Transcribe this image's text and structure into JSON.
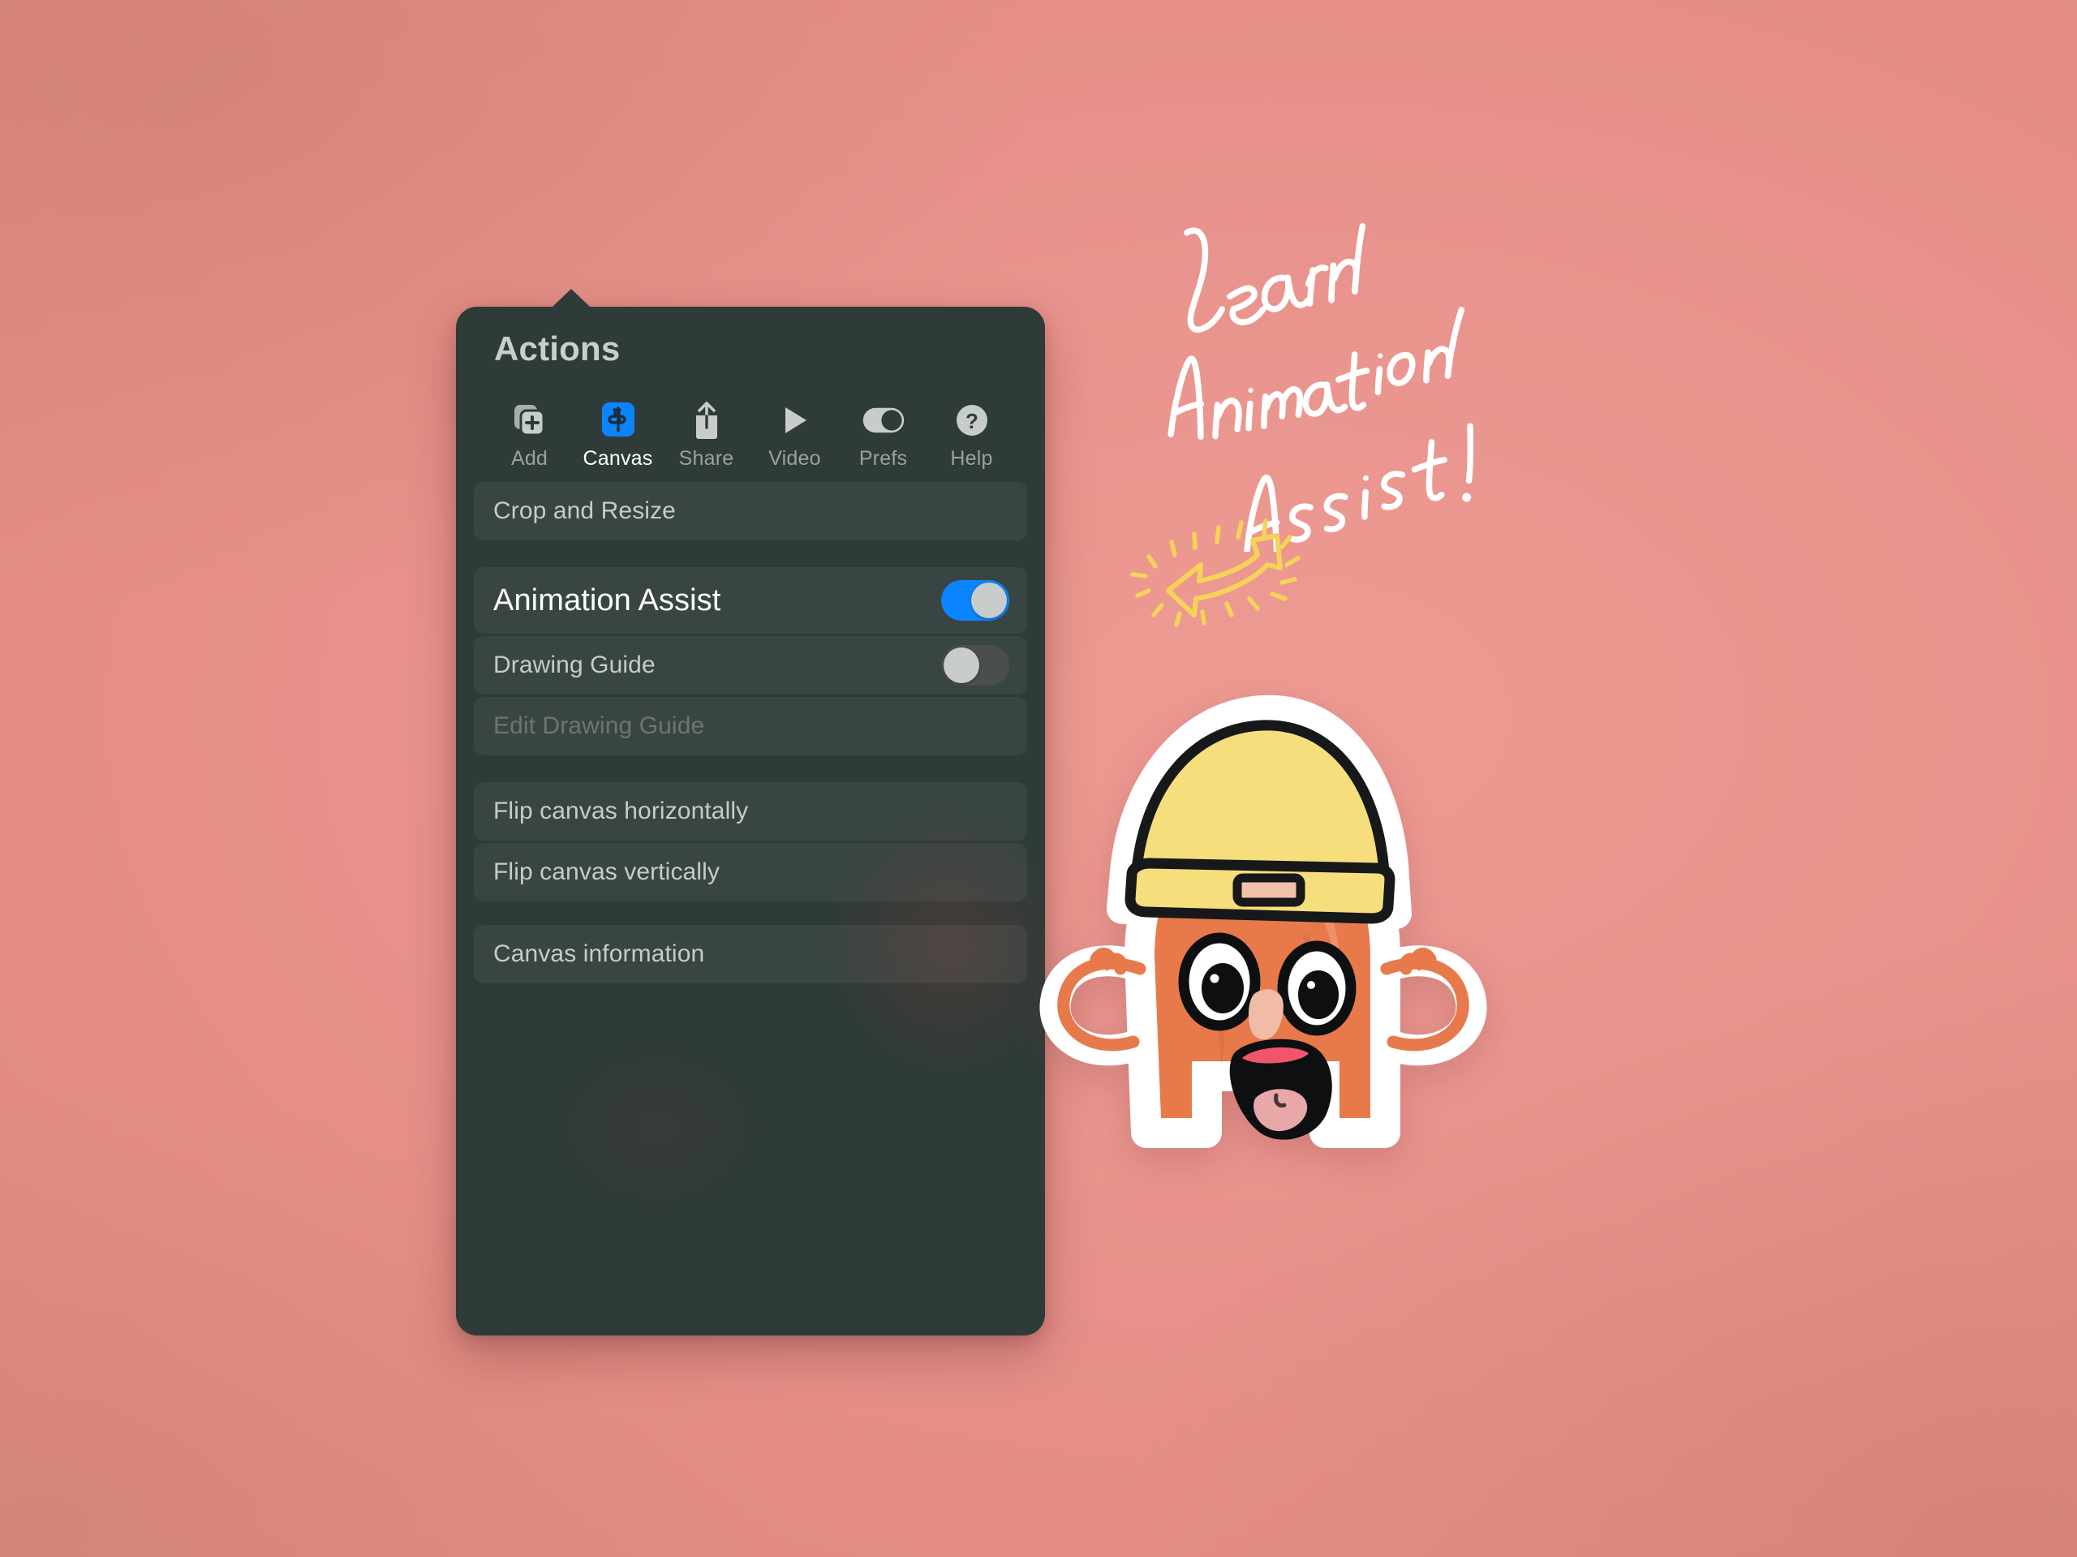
{
  "background": {
    "gradient_from": "#D28677",
    "gradient_to": "#E8918C"
  },
  "panel": {
    "title": "Actions",
    "background_color": "#2E3B39",
    "accent_color": "#0A84FF",
    "tabs": [
      {
        "label": "Add",
        "icon": "add-layer-icon",
        "active": false
      },
      {
        "label": "Canvas",
        "icon": "canvas-icon",
        "active": true
      },
      {
        "label": "Share",
        "icon": "share-icon",
        "active": false
      },
      {
        "label": "Video",
        "icon": "video-play-icon",
        "active": false
      },
      {
        "label": "Prefs",
        "icon": "toggle-icon",
        "active": false
      },
      {
        "label": "Help",
        "icon": "question-mark-icon",
        "active": false
      }
    ],
    "rows": [
      {
        "label": "Crop and Resize",
        "type": "action",
        "disabled": false
      },
      {
        "label": "Animation Assist",
        "type": "toggle",
        "value": "on",
        "emphasis": true
      },
      {
        "label": "Drawing Guide",
        "type": "toggle",
        "value": "off",
        "emphasis": false
      },
      {
        "label": "Edit Drawing Guide",
        "type": "action",
        "disabled": true
      },
      {
        "label": "Flip canvas horizontally",
        "type": "action",
        "disabled": false
      },
      {
        "label": "Flip canvas vertically",
        "type": "action",
        "disabled": false
      },
      {
        "label": "Canvas information",
        "type": "action",
        "disabled": false
      }
    ]
  },
  "annotations": {
    "handwritten_text": "Learn Animation Assist!",
    "handwritten_lines": [
      "Learn",
      "Animation",
      "Assist !"
    ],
    "handwritten_color": "#FFFFFF",
    "arrow": {
      "name": "hand-drawn-arrow-left",
      "color": "#F5D357",
      "direction": "left",
      "sparkles": true
    }
  },
  "sticker": {
    "name": "orange-character-with-beanie",
    "body_color": "#E8794B",
    "outline_color": "#FFFFFF",
    "hat_color": "#F7DE7C",
    "hat_outline_color": "#16181A",
    "tongue_color": "#E9A8A8",
    "mouth_color": "#111111",
    "upper_lip_color": "#F0566A",
    "expression": "surprised"
  }
}
